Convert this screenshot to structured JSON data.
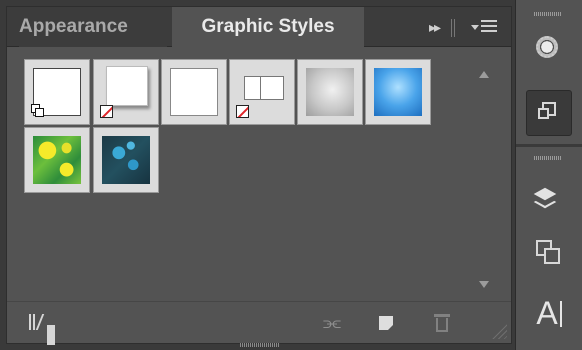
{
  "panel": {
    "tabs": [
      {
        "label": "Appearance",
        "active": false
      },
      {
        "label": "Graphic Styles",
        "active": true
      }
    ],
    "header_controls": {
      "collapse": "▸▸",
      "menu": "panel-menu"
    }
  },
  "swatches": [
    {
      "name": "Default Graphic Style",
      "kind": "plain",
      "marker": "copy"
    },
    {
      "name": "Drop Shadow",
      "kind": "shadow",
      "marker": "none"
    },
    {
      "name": "Basic",
      "kind": "plain"
    },
    {
      "name": "Rounded Corners",
      "kind": "double",
      "marker": "none"
    },
    {
      "name": "Gray Bevel",
      "kind": "gradient-gray"
    },
    {
      "name": "Blue Glow",
      "kind": "gradient-blue"
    },
    {
      "name": "Leaf Pattern",
      "kind": "pattern-leaf"
    },
    {
      "name": "Blue Swirl",
      "kind": "pattern-swirl"
    }
  ],
  "bottom_toolbar": {
    "library_menu": "graphic-styles-libraries",
    "break_link": "break-link",
    "new_style": "new-graphic-style",
    "delete": "delete-graphic-style"
  },
  "dock": {
    "buttons": [
      "appearance-panel",
      "graphic-styles-panel",
      "layers-panel",
      "artboards-panel",
      "character-panel"
    ],
    "type_glyph": "A"
  },
  "colors": {
    "panel_bg": "#535353",
    "tabbar_bg": "#3c3c3c",
    "active_tab_text": "#eaeaea",
    "inactive_tab_text": "#a9a9a9"
  }
}
